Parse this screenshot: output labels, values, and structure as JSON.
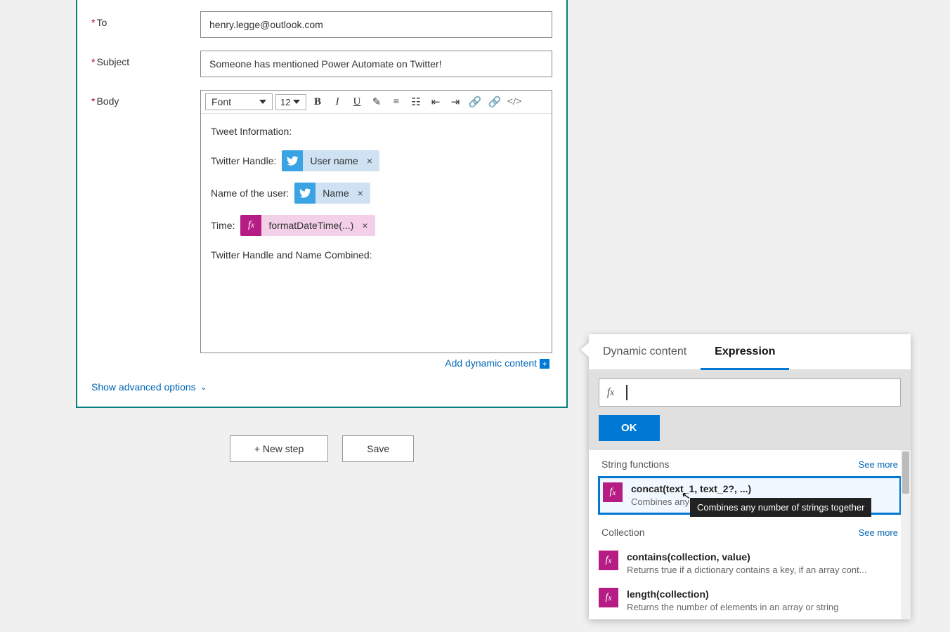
{
  "form": {
    "to_label": "To",
    "subject_label": "Subject",
    "body_label": "Body",
    "to_value": "henry.legge@outlook.com",
    "subject_value": "Someone has mentioned Power Automate on Twitter!",
    "font_label": "Font",
    "font_size": "12"
  },
  "body": {
    "line1": "Tweet Information:",
    "line2_prefix": "Twitter Handle:",
    "token_username": "User name",
    "line3_prefix": "Name of the user:",
    "token_name": "Name",
    "line4_prefix": "Time:",
    "token_fx": "formatDateTime(...)",
    "line5": "Twitter Handle and Name Combined:"
  },
  "links": {
    "add_dynamic": "Add dynamic content",
    "show_advanced": "Show advanced options"
  },
  "buttons": {
    "new_step": "+ New step",
    "save": "Save",
    "ok": "OK"
  },
  "popover": {
    "tab_dynamic": "Dynamic content",
    "tab_expression": "Expression",
    "section_string": "String functions",
    "section_collection": "Collection",
    "see_more": "See more",
    "functions": [
      {
        "sig": "concat(text_1, text_2?, ...)",
        "desc": "Combines any number of strings together"
      },
      {
        "sig": "contains(collection, value)",
        "desc": "Returns true if a dictionary contains a key, if an array cont..."
      },
      {
        "sig": "length(collection)",
        "desc": "Returns the number of elements in an array or string"
      }
    ],
    "tooltip": "Combines any number of strings together"
  }
}
